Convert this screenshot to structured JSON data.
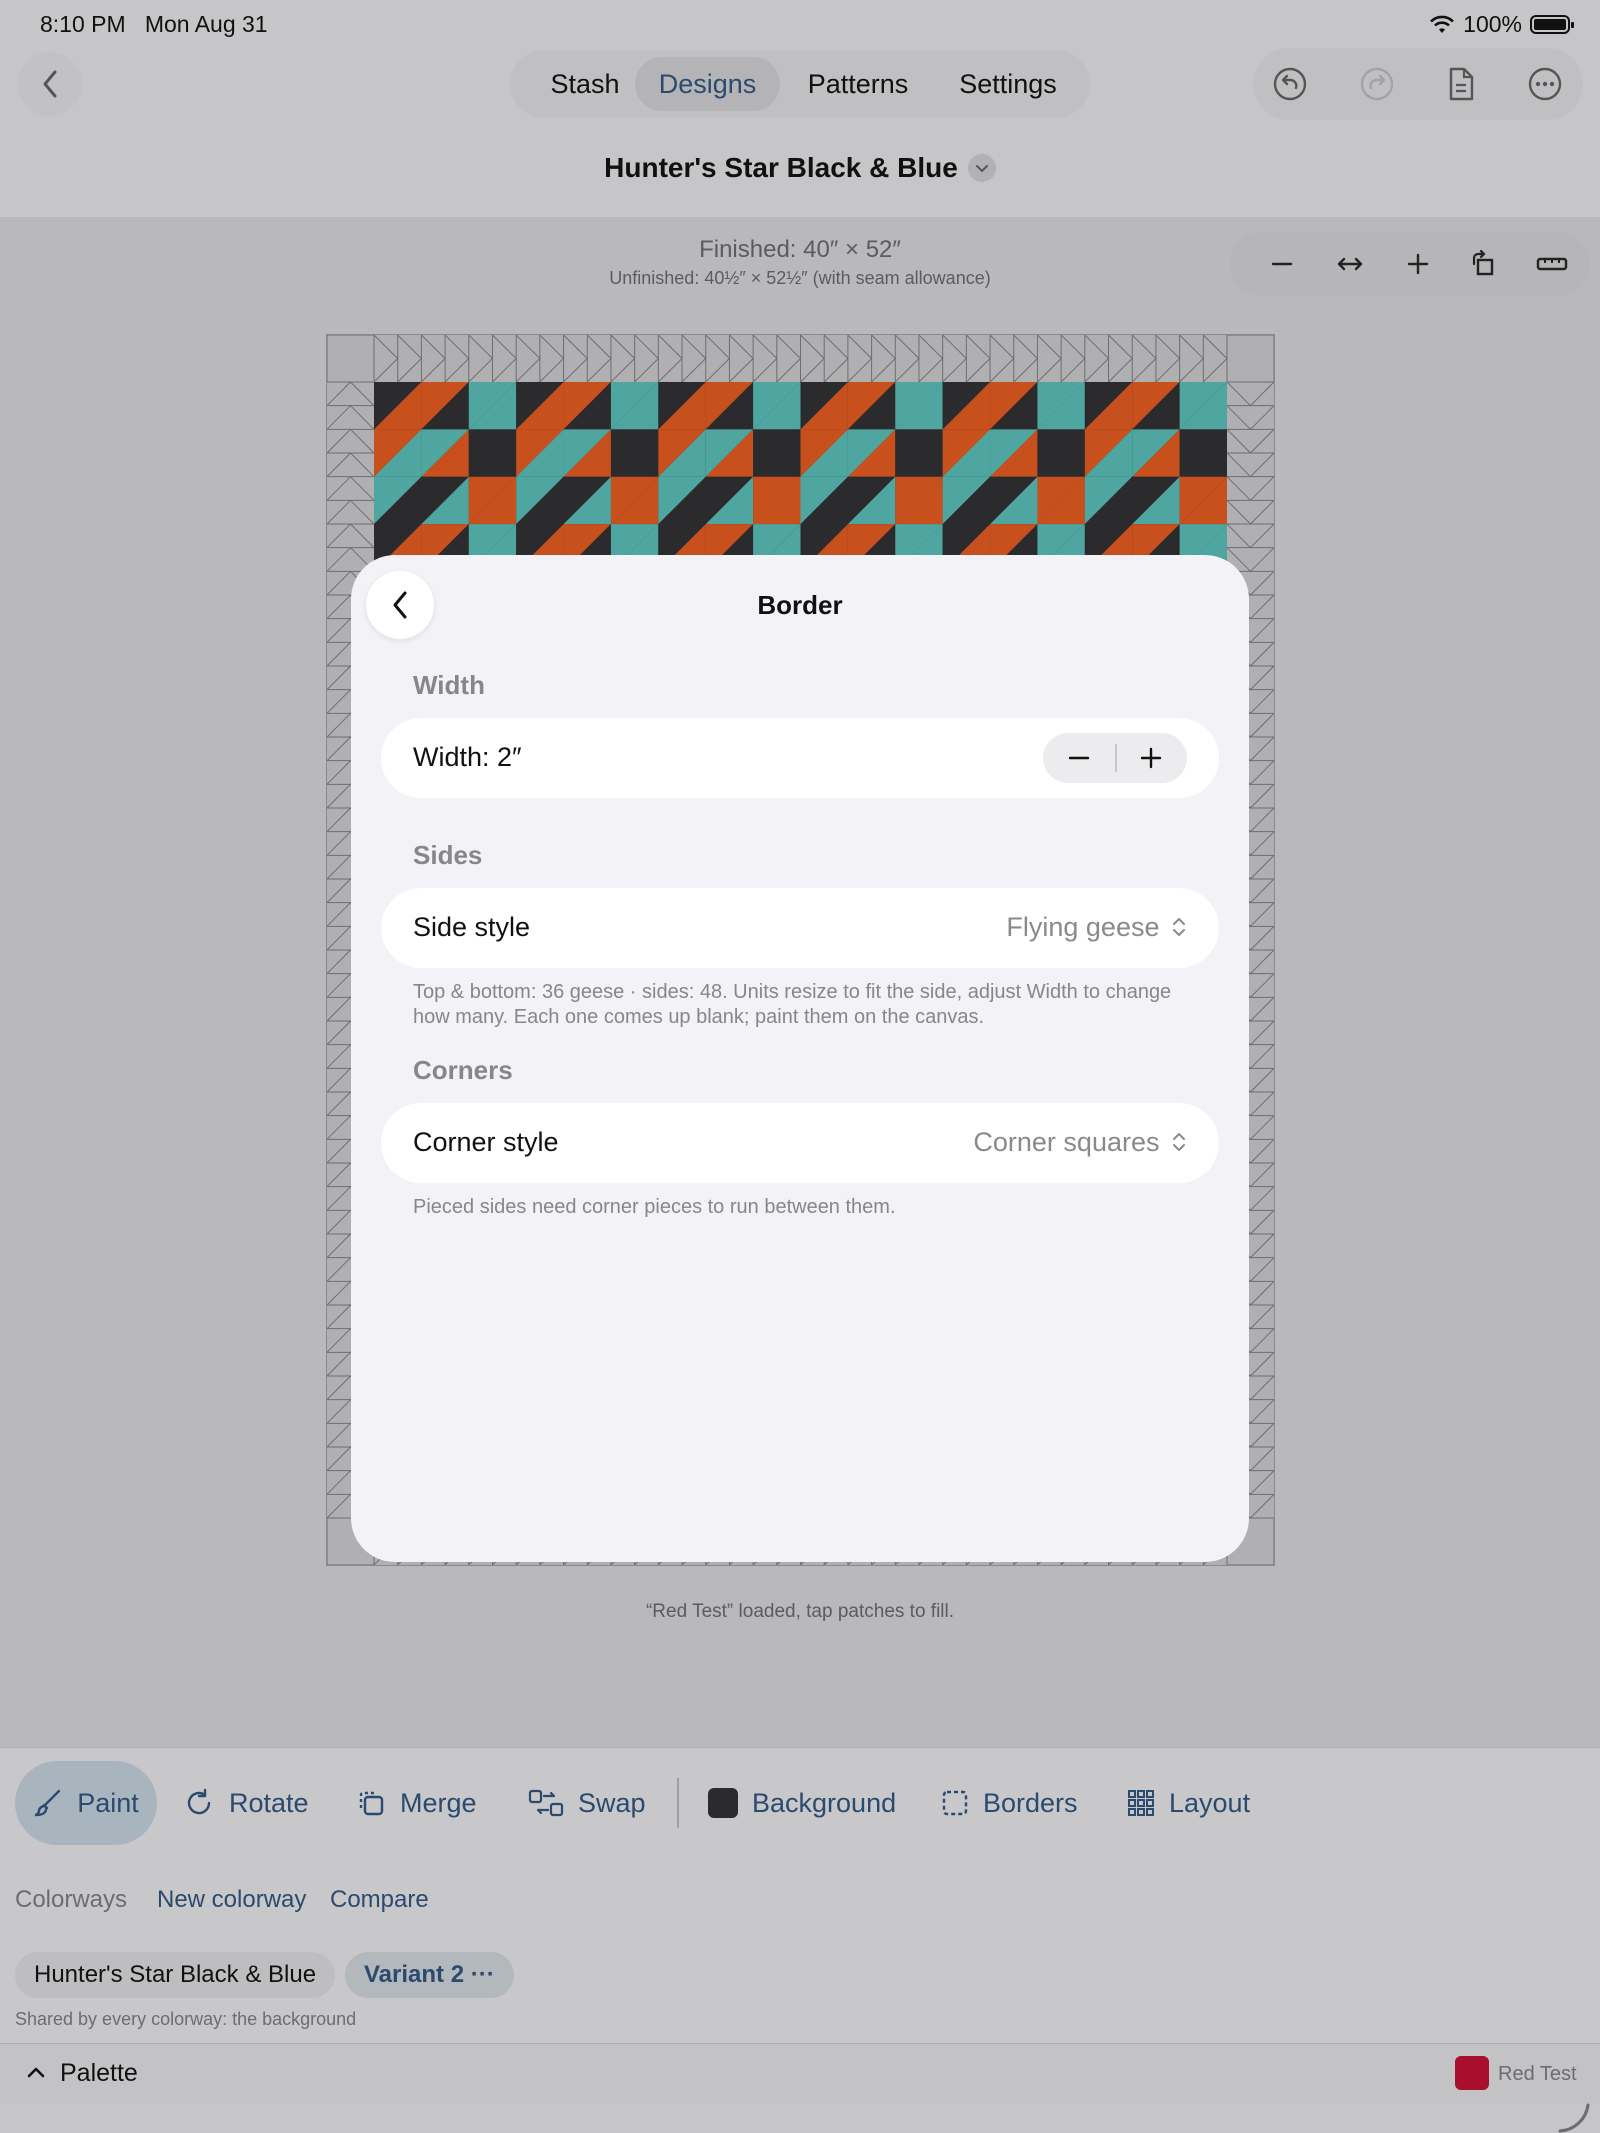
{
  "status_bar": {
    "time": "8:10 PM",
    "date": "Mon Aug 31",
    "battery": "100%"
  },
  "nav": {
    "tabs": [
      "Stash",
      "Designs",
      "Patterns",
      "Settings"
    ],
    "active_tab": "Designs",
    "icons": [
      "undo-icon",
      "redo-icon",
      "document-icon",
      "more-icon"
    ]
  },
  "document": {
    "title": "Hunter's Star Black & Blue"
  },
  "dimensions": {
    "finished": "Finished: 40″ × 52″",
    "unfinished": "Unfinished: 40½″ × 52½″ (with seam allowance)"
  },
  "canvas": {
    "status_message": "“Red Test” loaded, tap patches to fill."
  },
  "border_sheet": {
    "title": "Border",
    "width_section": "Width",
    "width_label": "Width: 2″",
    "sides_section": "Sides",
    "side_style_label": "Side style",
    "side_style_value": "Flying geese",
    "sides_note": "Top & bottom: 36 geese · sides: 48. Units resize to fit the side, adjust Width to change how many. Each one comes up blank; paint them on the canvas.",
    "corners_section": "Corners",
    "corner_style_label": "Corner style",
    "corner_style_value": "Corner squares",
    "corners_note": "Pieced sides need corner pieces to run between them."
  },
  "toolbar": {
    "paint": "Paint",
    "rotate": "Rotate",
    "merge": "Merge",
    "swap": "Swap",
    "background": "Background",
    "borders": "Borders",
    "layout": "Layout"
  },
  "colorways": {
    "label": "Colorways",
    "new_colorway": "New colorway",
    "compare": "Compare",
    "items": [
      "Hunter's Star Black & Blue",
      "Variant 2 ···"
    ],
    "shared_note": "Shared by every colorway: the background"
  },
  "palette": {
    "label": "Palette",
    "swatch_name": "Red Test",
    "swatch_color": "#a80f2c"
  },
  "colors": {
    "accent": "#2b4a6e",
    "orange_fabric": "#c8501d",
    "dark_fabric": "#2b2b2d",
    "teal_fabric": "#4fa6a0"
  }
}
